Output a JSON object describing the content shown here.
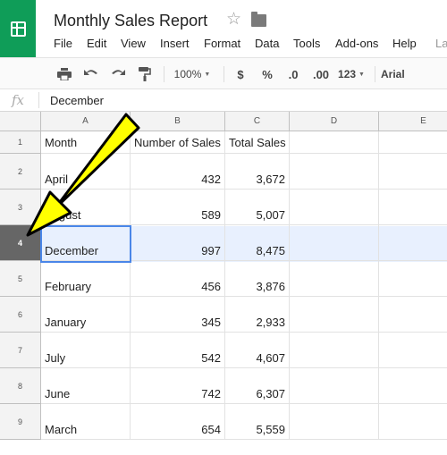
{
  "app": {
    "title": "Monthly Sales Report",
    "menu": [
      "File",
      "Edit",
      "View",
      "Insert",
      "Format",
      "Data",
      "Tools",
      "Add-ons",
      "Help",
      "La"
    ]
  },
  "toolbar": {
    "zoom": "100%",
    "currency": "$",
    "percent": "%",
    "decrease_decimals": ".0",
    "increase_decimals": ".00",
    "more_formats": "123",
    "font": "Arial"
  },
  "formula_bar": {
    "fx": "fx",
    "value": "December"
  },
  "columns": [
    "A",
    "B",
    "C",
    "D",
    "E"
  ],
  "rows": [
    {
      "num": "1",
      "cells": [
        "Month",
        "Number of Sales",
        "Total Sales",
        "",
        ""
      ]
    },
    {
      "num": "2",
      "cells": [
        "April",
        "432",
        "3,672",
        "",
        ""
      ]
    },
    {
      "num": "3",
      "cells": [
        "August",
        "589",
        "5,007",
        "",
        ""
      ]
    },
    {
      "num": "4",
      "cells": [
        "December",
        "997",
        "8,475",
        "",
        ""
      ]
    },
    {
      "num": "5",
      "cells": [
        "February",
        "456",
        "3,876",
        "",
        ""
      ]
    },
    {
      "num": "6",
      "cells": [
        "January",
        "345",
        "2,933",
        "",
        ""
      ]
    },
    {
      "num": "7",
      "cells": [
        "July",
        "542",
        "4,607",
        "",
        ""
      ]
    },
    {
      "num": "8",
      "cells": [
        "June",
        "742",
        "6,307",
        "",
        ""
      ]
    },
    {
      "num": "9",
      "cells": [
        "March",
        "654",
        "5,559",
        "",
        ""
      ]
    }
  ],
  "colors": {
    "brand": "#0f9d58",
    "selection_fill": "#e8f0fe",
    "selection_border": "#4a86e8",
    "annotation_arrow": "#ffff00"
  }
}
